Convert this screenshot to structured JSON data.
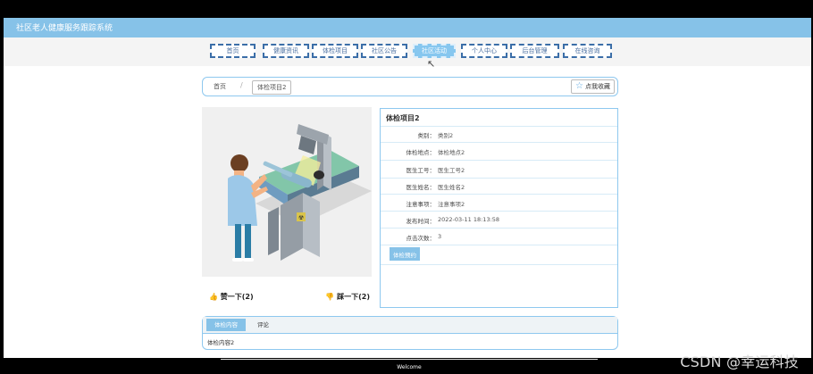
{
  "app": {
    "title": "社区老人健康服务跟踪系统"
  },
  "nav": {
    "items": [
      {
        "label": "首页",
        "active": false
      },
      {
        "label": "健康资讯",
        "active": false
      },
      {
        "label": "体检项目",
        "active": false
      },
      {
        "label": "社区公告",
        "active": false
      },
      {
        "label": "社区活动",
        "active": true
      },
      {
        "label": "个人中心",
        "active": false
      },
      {
        "label": "后台管理",
        "active": false
      },
      {
        "label": "在线咨询",
        "active": false
      }
    ]
  },
  "breadcrumb": {
    "home": "首页",
    "separator": "/",
    "current": "体检项目2"
  },
  "favorite": {
    "label": "点我收藏",
    "icon": "star-icon"
  },
  "reactions": {
    "like_label": "赞一下(2)",
    "dislike_label": "踩一下(2)"
  },
  "details": {
    "title": "体检项目2",
    "fields": [
      {
        "label": "类别：",
        "value": "类别2"
      },
      {
        "label": "体检地点：",
        "value": "体检地点2"
      },
      {
        "label": "医生工号：",
        "value": "医生工号2"
      },
      {
        "label": "医生姓名：",
        "value": "医生姓名2"
      },
      {
        "label": "注意事项：",
        "value": "注意事项2"
      },
      {
        "label": "发布时间：",
        "value": "2022-03-11 18:13:58"
      },
      {
        "label": "点击次数：",
        "value": "3"
      }
    ],
    "button_label": "体检预约"
  },
  "tabs": {
    "items": [
      "体检内容",
      "评论"
    ],
    "content": "体检内容2"
  },
  "footer": {
    "text": "Welcome"
  },
  "watermark": "CSDN @幸运科技"
}
